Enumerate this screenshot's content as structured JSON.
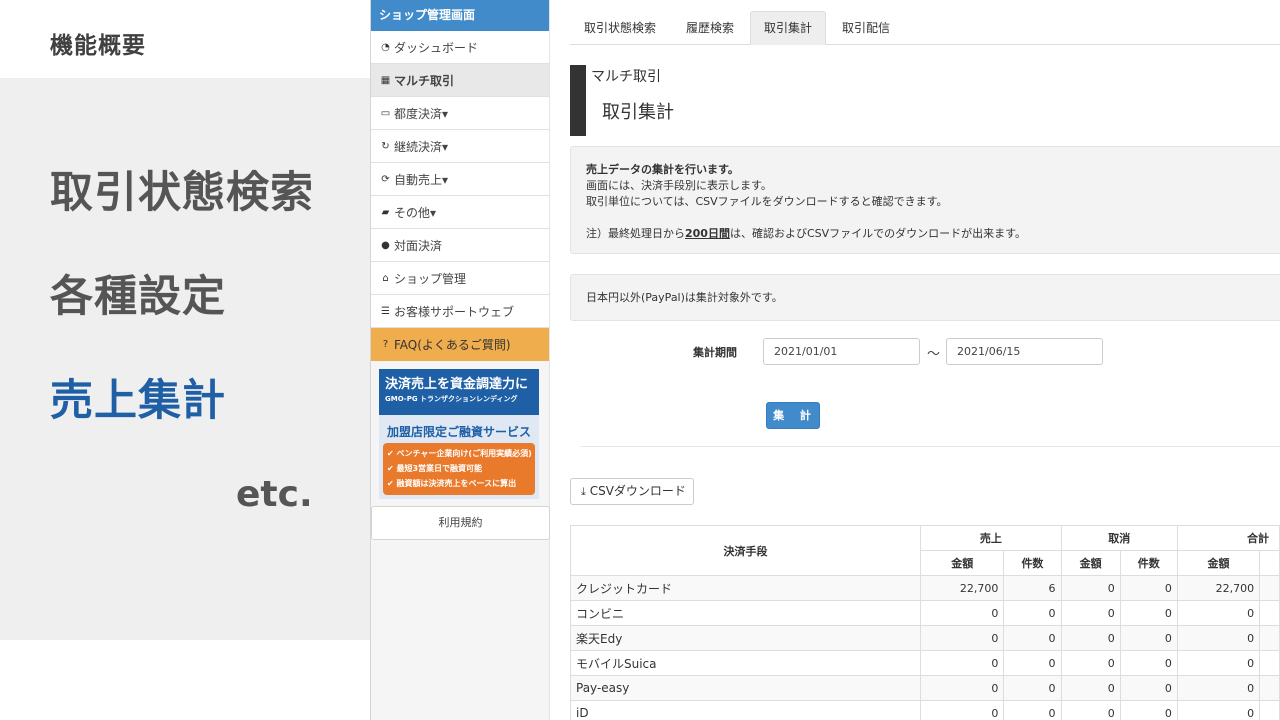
{
  "slide": {
    "title": "機能概要",
    "items": [
      {
        "label": "取引状態検索",
        "active": false
      },
      {
        "label": "各種設定",
        "active": false
      },
      {
        "label": "売上集計",
        "active": true
      }
    ],
    "etc": "etc.",
    "colors": {
      "accent": "#1f5fa6",
      "text": "#555555",
      "panel": "#efefef"
    }
  },
  "sidebar": {
    "header": "ショップ管理画面",
    "items": [
      {
        "label": "ダッシュボード",
        "icon": "dashboard-icon"
      },
      {
        "label": "マルチ取引",
        "icon": "grid-icon",
        "active": true
      },
      {
        "label": "都度決済▾",
        "icon": "credit-card-icon"
      },
      {
        "label": "継続決済▾",
        "icon": "refresh-icon"
      },
      {
        "label": "自動売上▾",
        "icon": "sync-icon"
      },
      {
        "label": "その他▾",
        "icon": "folder-icon"
      },
      {
        "label": "対面決済",
        "icon": "user-icon"
      },
      {
        "label": "ショップ管理",
        "icon": "home-icon"
      },
      {
        "label": "お客様サポートウェブ",
        "icon": "list-icon"
      }
    ],
    "faq": "FAQ(よくあるご質問)",
    "banner": {
      "line1": "決済売上を資金調達力に",
      "line2": "GMO-PG トランザクションレンディング",
      "line3": "加盟店限定ご融資サービス",
      "bullets": [
        "✔ ベンチャー企業向け(ご利用実績必須)",
        "✔ 最短3営業日で融資可能",
        "✔ 融資額は決済売上をベースに算出"
      ]
    },
    "terms": "利用規約"
  },
  "tabs": [
    {
      "label": "取引状態検索",
      "active": false
    },
    {
      "label": "履歴検索",
      "active": false
    },
    {
      "label": "取引集計",
      "active": true
    },
    {
      "label": "取引配信",
      "active": false
    }
  ],
  "page": {
    "subtitle": "マルチ取引",
    "title": "取引集計"
  },
  "info": {
    "line1": "売上データの集計を行います。",
    "line2": "画面には、決済手段別に表示します。",
    "line3": "取引単位については、CSVファイルをダウンロードすると確認できます。",
    "note_prefix": "注）最終処理日から",
    "note_days": "200日間",
    "note_suffix": "は、確認およびCSVファイルでのダウンロードが出来ます。",
    "note2": "日本円以外(PayPal)は集計対象外です。"
  },
  "form": {
    "period_label": "集計期間",
    "date_from": "2021/01/01",
    "tilde": "～",
    "date_to": "2021/06/15",
    "submit": "集 計",
    "csv": "CSVダウンロード"
  },
  "table": {
    "col_method": "決済手段",
    "groups": [
      "売上",
      "取消",
      "合計"
    ],
    "sub_amount": "金額",
    "sub_count": "件数",
    "rows": [
      {
        "method": "クレジットカード",
        "sales_amount": "22,700",
        "sales_count": "6",
        "cancel_amount": "0",
        "cancel_count": "0",
        "total_amount": "22,700"
      },
      {
        "method": "コンビニ",
        "sales_amount": "0",
        "sales_count": "0",
        "cancel_amount": "0",
        "cancel_count": "0",
        "total_amount": "0"
      },
      {
        "method": "楽天Edy",
        "sales_amount": "0",
        "sales_count": "0",
        "cancel_amount": "0",
        "cancel_count": "0",
        "total_amount": "0"
      },
      {
        "method": "モバイルSuica",
        "sales_amount": "0",
        "sales_count": "0",
        "cancel_amount": "0",
        "cancel_count": "0",
        "total_amount": "0"
      },
      {
        "method": "Pay-easy",
        "sales_amount": "0",
        "sales_count": "0",
        "cancel_amount": "0",
        "cancel_count": "0",
        "total_amount": "0"
      },
      {
        "method": "iD",
        "sales_amount": "0",
        "sales_count": "0",
        "cancel_amount": "0",
        "cancel_count": "0",
        "total_amount": "0"
      }
    ]
  },
  "colors": {
    "primary": "#428bca",
    "faq": "#f0ad4e",
    "banner_blue": "#1f5fa6",
    "banner_orange": "#ea7a2b"
  }
}
